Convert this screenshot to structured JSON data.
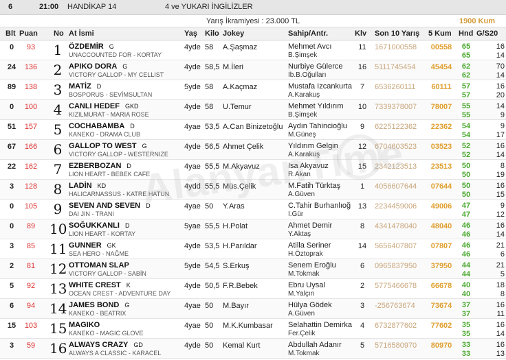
{
  "race": {
    "number": "6",
    "time": "21:00",
    "type": "HANDİKAP 14",
    "conditions": "4 ve YUKARI İNGİLİZLER",
    "prize_label": "Yarış İkramiyesi :",
    "prize_value": "23.000 TL",
    "track": "1900 Kum"
  },
  "columns": {
    "blt": "Blt",
    "puan": "Puan",
    "no": "No",
    "name": "At İsmi",
    "yas": "Yaş",
    "kilo": "Kilo",
    "jokey": "Jokey",
    "owner": "Sahip/Antr.",
    "klv": "Klv",
    "son10": "Son 10 Yarış",
    "kum5": "5 Kum",
    "hnd": "Hnd",
    "gs20": "G/S20"
  },
  "watermark": "AlanyanTime",
  "horses": [
    {
      "blt": "0",
      "puan": "93",
      "no": "1",
      "name": "ÖZDEMİR",
      "gender": "G",
      "pedigree": "UNACCOUNTED FOR - KORTAY",
      "yas": "4yde",
      "kilo": "58",
      "jokey": "A.Şaşmaz",
      "owner": "Mehmet Avcı",
      "trainer": "B.Şimşek",
      "klv": "11",
      "son10a": "1671000558",
      "son10b": "",
      "kum5": "00558",
      "hnd1": "65",
      "hnd2": "65",
      "g1": "16",
      "g2": "14"
    },
    {
      "blt": "24",
      "puan": "136",
      "no": "2",
      "name": "APIKO DORA",
      "gender": "G",
      "pedigree": "VICTORY GALLOP - MY CELLIST",
      "yas": "4yde",
      "kilo": "58,5",
      "jokey": "M.İleri",
      "owner": "Nurbiye Gülerce",
      "trainer": "İb.B.Oğulları",
      "klv": "16",
      "son10a": "5111745454",
      "son10b": "",
      "kum5": "45454",
      "hnd1": "62",
      "hnd2": "62",
      "g1": "70",
      "g2": "14"
    },
    {
      "blt": "89",
      "puan": "138",
      "no": "3",
      "name": "MATİZ",
      "gender": "D",
      "pedigree": "BOSPORUS - SEVİMSULTAN",
      "yas": "5yde",
      "kilo": "58",
      "jokey": "A.Kaçmaz",
      "owner": "Mustafa Izcankurta",
      "trainer": "A.Karakuş",
      "klv": "7",
      "son10a": "6536260111",
      "son10b": "",
      "kum5": "60111",
      "hnd1": "57",
      "hnd2": "57",
      "g1": "16",
      "g2": "20"
    },
    {
      "blt": "0",
      "puan": "100",
      "no": "4",
      "name": "CANLI HEDEF",
      "gender": "GKD",
      "pedigree": "KIZILMURAT - MARIA ROSE",
      "yas": "4yde",
      "kilo": "58",
      "jokey": "U.Temur",
      "owner": "Mehmet Yıldırım",
      "trainer": "B.Şimşek",
      "klv": "10",
      "son10a": "7339378007",
      "son10b": "",
      "kum5": "78007",
      "hnd1": "55",
      "hnd2": "55",
      "g1": "14",
      "g2": "9"
    },
    {
      "blt": "51",
      "puan": "157",
      "no": "5",
      "name": "COCHABAMBA",
      "gender": "D",
      "pedigree": "KANEKO - DRAMA CLUB",
      "yas": "4yae",
      "kilo": "53,5",
      "jokey": "A.Can Binizetoğlu",
      "owner": "Aydın Tahincioğlu",
      "trainer": "M.Güneş",
      "klv": "9",
      "son10a": "6225122362",
      "son10b": "",
      "kum5": "22362",
      "hnd1": "54",
      "hnd2": "54",
      "g1": "9",
      "g2": "17"
    },
    {
      "blt": "67",
      "puan": "166",
      "no": "6",
      "name": "GALLOP TO WEST",
      "gender": "G",
      "pedigree": "VICTORY GALLOP - WESTERNIZE",
      "yas": "4yde",
      "kilo": "56,5",
      "jokey": "Ahmet Çelik",
      "owner": "Yıldırım Gelgin",
      "trainer": "A.Karakuş",
      "klv": "12",
      "son10a": "6704603523",
      "son10b": "",
      "kum5": "03523",
      "hnd1": "52",
      "hnd2": "52",
      "g1": "16",
      "g2": "14"
    },
    {
      "blt": "22",
      "puan": "162",
      "no": "7",
      "name": "EZBERBOZAN",
      "gender": "D",
      "pedigree": "LION HEART - BEBEK CAFE",
      "yas": "4yae",
      "kilo": "55,5",
      "jokey": "M.Akyavuz",
      "owner": "Isa Akyavuz",
      "trainer": "R.Akan",
      "klv": "15",
      "son10a": "2342123513",
      "son10b": "",
      "kum5": "23513",
      "hnd1": "50",
      "hnd2": "50",
      "g1": "8",
      "g2": "19"
    },
    {
      "blt": "3",
      "puan": "128",
      "no": "8",
      "name": "LADİN",
      "gender": "KD",
      "pedigree": "HALICARNASSUS - KATRE HATUN",
      "yas": "4ydd",
      "kilo": "55,5",
      "jokey": "Müs.Çelik",
      "owner": "M.Fatih Türktaş",
      "trainer": "A.Güven",
      "klv": "1",
      "son10a": "4056607644",
      "son10b": "",
      "kum5": "07644",
      "hnd1": "50",
      "hnd2": "50",
      "g1": "16",
      "g2": "15"
    },
    {
      "blt": "0",
      "puan": "105",
      "no": "9",
      "name": "SEVEN AND SEVEN",
      "gender": "D",
      "pedigree": "DAI JIN - TRANI",
      "yas": "4yae",
      "kilo": "50",
      "jokey": "Y.Aras",
      "owner": "C.Tahir Burhanlıoğ",
      "trainer": "I.Gür",
      "klv": "13",
      "son10a": "2234459006",
      "son10b": "",
      "kum5": "49006",
      "hnd1": "47",
      "hnd2": "47",
      "g1": "9",
      "g2": "12"
    },
    {
      "blt": "0",
      "puan": "89",
      "no": "10",
      "name": "SOĞUKKANLI",
      "gender": "D",
      "pedigree": "LION HEART - KORTAY",
      "yas": "5yae",
      "kilo": "55,5",
      "jokey": "H.Polat",
      "owner": "Ahmet Demir",
      "trainer": "Y.Aktaş",
      "klv": "8",
      "son10a": "4341478040",
      "son10b": "",
      "kum5": "48040",
      "hnd1": "46",
      "hnd2": "46",
      "g1": "16",
      "g2": "14"
    },
    {
      "blt": "3",
      "puan": "85",
      "no": "11",
      "name": "GUNNER",
      "gender": "GK",
      "pedigree": "SEA HERO - NAĞME",
      "yas": "4yde",
      "kilo": "53,5",
      "jokey": "H.Parıldar",
      "owner": "Atilla Seriner",
      "trainer": "H.Öztoprak",
      "klv": "14",
      "son10a": "5656407807",
      "son10b": "",
      "kum5": "07807",
      "hnd1": "46",
      "hnd2": "46",
      "g1": "21",
      "g2": "6"
    },
    {
      "blt": "2",
      "puan": "81",
      "no": "12",
      "name": "OTTOMAN SLAP",
      "gender": "",
      "pedigree": "VICTORY GALLOP - SABİN",
      "yas": "5yde",
      "kilo": "54,5",
      "jokey": "S.Erkuş",
      "owner": "Senem Eroğlu",
      "trainer": "M.Tokmak",
      "klv": "6",
      "son10a": "0965837950",
      "son10b": "",
      "kum5": "37950",
      "hnd1": "44",
      "hnd2": "44",
      "g1": "21",
      "g2": "5"
    },
    {
      "blt": "5",
      "puan": "92",
      "no": "13",
      "name": "WHITE CREST",
      "gender": "K",
      "pedigree": "OCEAN CREST - ADVENTURE DAY",
      "yas": "4yde",
      "kilo": "50,5",
      "jokey": "F.R.Bebek",
      "owner": "Ebru Uysal",
      "trainer": "M.Yalçın",
      "klv": "2",
      "son10a": "5775466678",
      "son10b": "",
      "kum5": "66678",
      "hnd1": "40",
      "hnd2": "40",
      "g1": "18",
      "g2": "8"
    },
    {
      "blt": "6",
      "puan": "94",
      "no": "14",
      "name": "JAMES BOND",
      "gender": "G",
      "pedigree": "KANEKO - BEATRIX",
      "yas": "4yae",
      "kilo": "50",
      "jokey": "M.Bayır",
      "owner": "Hülya Gödek",
      "trainer": "A.Güven",
      "klv": "3",
      "son10a": "-256763674",
      "son10b": "",
      "kum5": "73674",
      "hnd1": "37",
      "hnd2": "37",
      "g1": "16",
      "g2": "11"
    },
    {
      "blt": "15",
      "puan": "103",
      "no": "15",
      "name": "MAGIKO",
      "gender": "",
      "pedigree": "KANEKO - MAGIC GLOVE",
      "yas": "4yae",
      "kilo": "50",
      "jokey": "M.K.Kumbasar",
      "owner": "Selahattin Demirka",
      "trainer": "Fer.Çelik",
      "klv": "4",
      "son10a": "6732877602",
      "son10b": "",
      "kum5": "77602",
      "hnd1": "35",
      "hnd2": "35",
      "g1": "16",
      "g2": "14"
    },
    {
      "blt": "3",
      "puan": "59",
      "no": "16",
      "name": "ALWAYS CRAZY",
      "gender": "GD",
      "pedigree": "ALWAYS A CLASSIC - KARACEL",
      "yas": "4yde",
      "kilo": "50",
      "jokey": "Kemal Kurt",
      "owner": "Abdullah Adanır",
      "trainer": "M.Tokmak",
      "klv": "5",
      "son10a": "5716580970",
      "son10b": "",
      "kum5": "80970",
      "hnd1": "33",
      "hnd2": "33",
      "g1": "16",
      "g2": "13"
    }
  ]
}
